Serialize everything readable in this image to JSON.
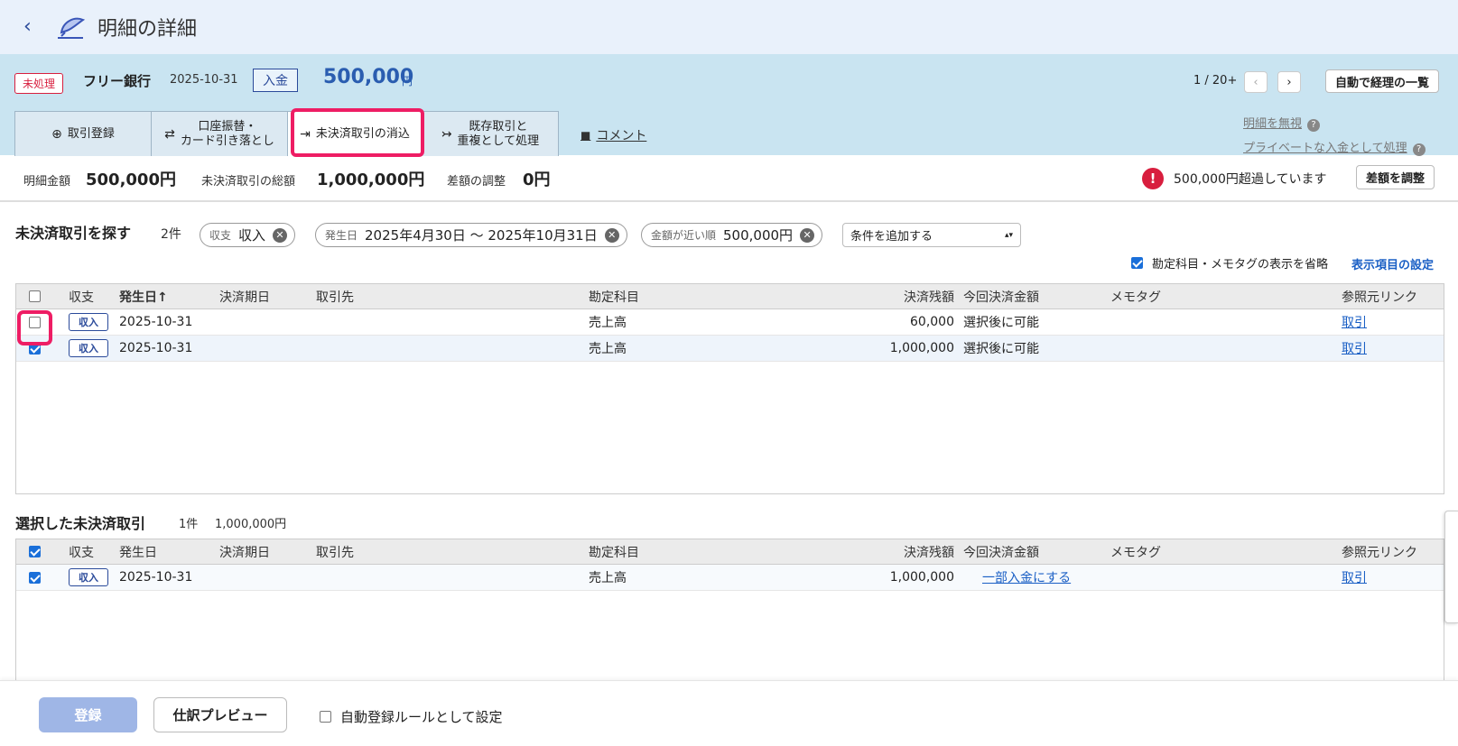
{
  "header": {
    "title": "明細の詳細"
  },
  "txn": {
    "status": "未処理",
    "bank": "フリー銀行",
    "date": "2025-10-31",
    "type": "入金",
    "amount": "500,000",
    "unit": "円",
    "pager": "1 / 20+",
    "auto_list_label": "自動で経理の一覧"
  },
  "tabs": {
    "register": "取引登録",
    "transfer_l1": "口座振替・",
    "transfer_l2": "カード引き落とし",
    "reconcile": "未決済取引の消込",
    "duplicate_l1": "既存取引と",
    "duplicate_l2": "重複として処理",
    "comment": "コメント",
    "ignore": "明細を無視",
    "private": "プライベートな入金として処理"
  },
  "summary": {
    "detail_label": "明細金額",
    "detail_value": "500,000円",
    "total_label": "未決済取引の総額",
    "total_value": "1,000,000円",
    "diff_label": "差額の調整",
    "diff_value": "0円",
    "alert": "500,000円超過しています",
    "adjust_btn": "差額を調整"
  },
  "search": {
    "title": "未決済取引を探す",
    "count": "2件",
    "chips": [
      {
        "key": "収支",
        "value": "収入"
      },
      {
        "key": "発生日",
        "value": "2025年4月30日 〜 2025年10月31日"
      },
      {
        "key": "金額が近い順",
        "value": "500,000円"
      }
    ],
    "add_condition": "条件を追加する",
    "omit_label": "勘定科目・メモタグの表示を省略",
    "display_settings": "表示項目の設定"
  },
  "columns": {
    "kind": "収支",
    "date": "発生日",
    "date_sorted": "発生日↑",
    "due": "決済期日",
    "partner": "取引先",
    "account": "勘定科目",
    "balance": "決済残額",
    "this_amount": "今回決済金額",
    "memo": "メモタグ",
    "ref": "参照元リンク"
  },
  "search_rows": [
    {
      "kind": "収入",
      "date": "2025-10-31",
      "account": "売上高",
      "balance": "60,000",
      "this_amount": "選択後に可能",
      "ref": "取引",
      "checked": false
    },
    {
      "kind": "収入",
      "date": "2025-10-31",
      "account": "売上高",
      "balance": "1,000,000",
      "this_amount": "選択後に可能",
      "ref": "取引",
      "checked": true
    }
  ],
  "selected": {
    "title": "選択した未決済取引",
    "count": "1件",
    "total": "1,000,000円",
    "rows": [
      {
        "kind": "収入",
        "date": "2025-10-31",
        "account": "売上高",
        "balance": "1,000,000",
        "this_amount": "一部入金にする",
        "ref": "取引"
      }
    ]
  },
  "footer": {
    "register": "登録",
    "preview": "仕訳プレビュー",
    "auto_rule": "自動登録ルールとして設定"
  }
}
